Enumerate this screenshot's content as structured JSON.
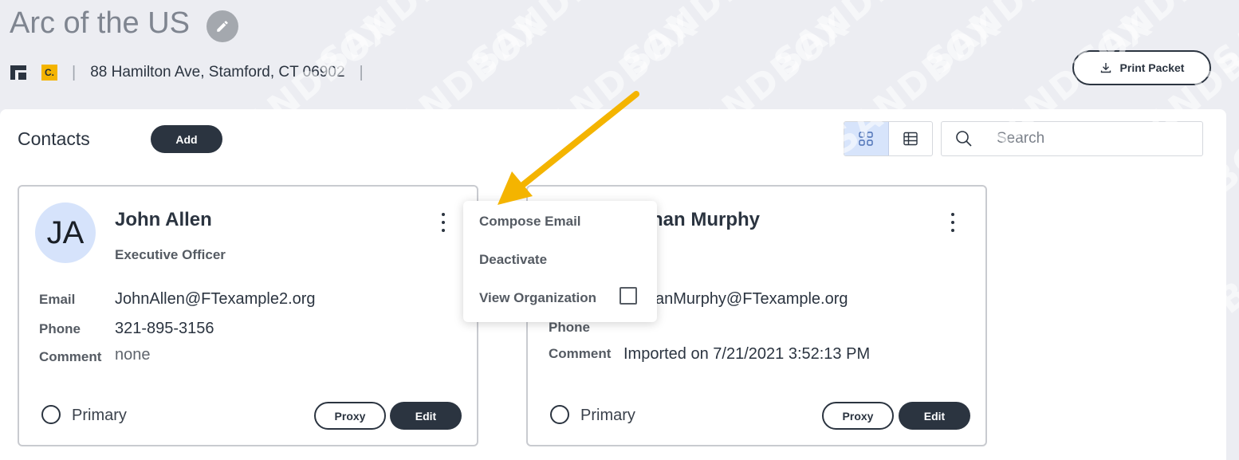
{
  "header": {
    "title": "Arc of the US",
    "badge": "C.",
    "address": "88 Hamilton Ave, Stamford, CT 06902",
    "separator": "|",
    "print_label": "Print Packet"
  },
  "watermark": "SANDBOX",
  "contacts": {
    "title": "Contacts",
    "add_label": "Add",
    "search_placeholder": "Search"
  },
  "cards": [
    {
      "initials": "JA",
      "name": "John Allen",
      "role": "Executive Officer",
      "email_label": "Email",
      "email": "JohnAllen@FTexample2.org",
      "phone_label": "Phone",
      "phone": "321-895-3156",
      "comment_label": "Comment",
      "comment": "none",
      "primary_label": "Primary",
      "proxy_label": "Proxy",
      "edit_label": "Edit"
    },
    {
      "name": "han Murphy",
      "email": "anMurphy@FTexample.org",
      "phone_label": "Phone",
      "comment_label": "Comment",
      "comment": "Imported on 7/21/2021 3:52:13 PM",
      "primary_label": "Primary",
      "proxy_label": "Proxy",
      "edit_label": "Edit"
    }
  ],
  "menu": {
    "items": [
      "Compose Email",
      "Deactivate",
      "View Organization"
    ]
  },
  "colors": {
    "primary_dark": "#2b3440",
    "arrow": "#f4b400",
    "badge": "#f4b400",
    "active_view": "#d7e4fb"
  }
}
